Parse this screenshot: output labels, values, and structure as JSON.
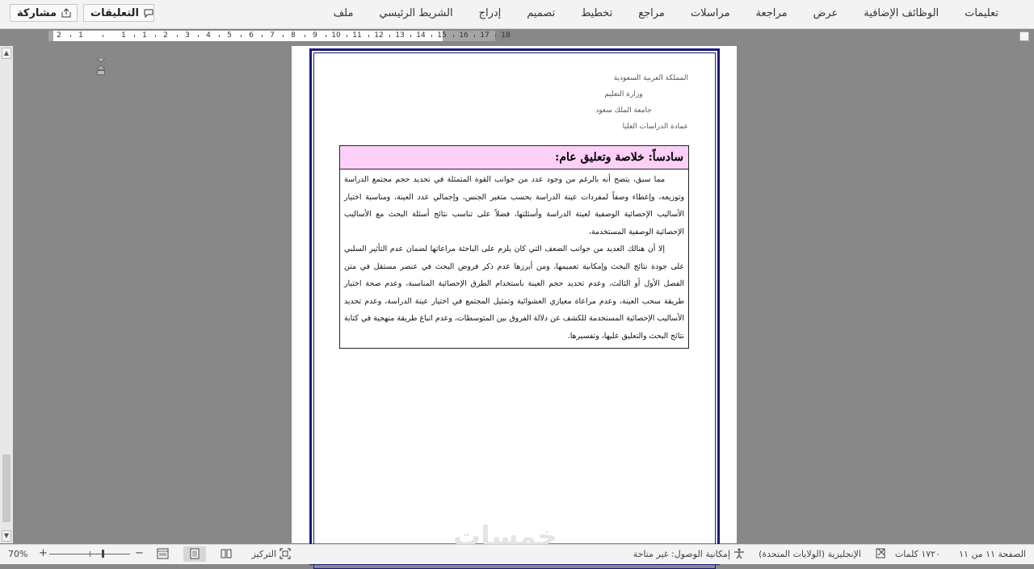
{
  "ribbon": {
    "tabs": [
      "ملف",
      "الشريط الرئيسي",
      "إدراج",
      "تصميم",
      "تخطيط",
      "مراجع",
      "مراسلات",
      "مراجعة",
      "عرض",
      "الوظائف الإضافية",
      "تعليمات"
    ],
    "share_label": "مشاركة",
    "comments_label": "التعليقات"
  },
  "ruler": {
    "numbers": [
      "2",
      "1",
      "1",
      "1",
      "2",
      "3",
      "4",
      "5",
      "6",
      "7",
      "8",
      "9",
      "10",
      "11",
      "12",
      "13",
      "14",
      "15",
      "16",
      "17",
      "18"
    ]
  },
  "document": {
    "letterhead": [
      "المملكة العربية السعودية",
      "وزارة التعليم",
      "جامعة الملك سعود",
      "عمادة الدراسات العليا"
    ],
    "section_title": "سادساً: خلاصة وتعليق عام:",
    "paragraphs": [
      "مما سبق، يتضح أنه بالرغم من وجود عدد من جوانب القوة المتمثلة في تحديد حجم مجتمع الدراسة وتوزيعه، وإعطاء وصفاً لمفردات عينة الدراسة بحسب متغير الجنس، وإجمالي عدد العينة، ومناسبة اختيار الأساليب الإحصائية الوصفية لعينة الدراسة وأسئلتها، فضلاً على تناسب نتائج أسئلة البحث مع الأساليب الإحصائية الوصفية المستخدمة،",
      "إلا أن هنالك العديد من جوانب الضعف التي كان يلزم على الباحثة مراعاتها لضمان عدم التأثير السلبي على جودة نتائج البحث وإمكانية تعميمها، ومن أبرزها عدم ذكر فروض البحث في عنصر مستقل في متن الفصل الأول أو الثالث، وعدم تحديد حجم العينة باستخدام الطرق الإحصائية المناسبة، وعدم صحة اختيار طريقة سحب العينة، وعدم مراعاة معياري العشوائية وتمثيل المجتمع في اختيار عينة الدراسة، وعدم تحديد الأساليب الإحصائية المستخدمة للكشف عن دلالة الفروق بين المتوسطات، وعدم اتباع طريقة منهجية في كتابة نتائج البحث والتعليق عليها، وتفسيرها."
    ],
    "watermark": "خمسات"
  },
  "status": {
    "page": "الصفحة ١١ من ١١",
    "words": "١٧٢٠ كلمات",
    "language": "الإنجليزية (الولايات المتحدة)",
    "accessibility": "إمكانية الوصول: غير متاحة",
    "focus": "التركيز",
    "zoom": "70%",
    "zoom_level": 0.7
  },
  "colors": {
    "page_border": "#1a1a78",
    "heading_fill": "#fdd0f8",
    "background": "#888888"
  }
}
